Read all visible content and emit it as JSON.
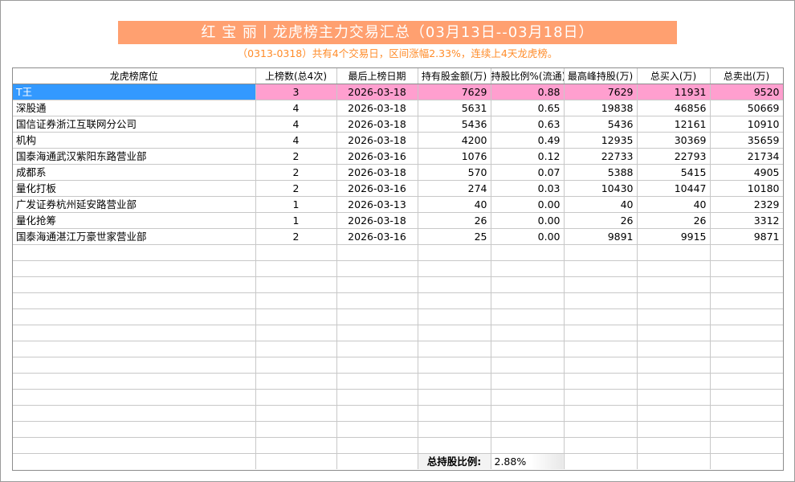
{
  "header": {
    "title": "红 宝 丽丨龙虎榜主力交易汇总（03月13日--03月18日）",
    "subtitle": "（0313-0318）共有4个交易日，区间涨幅2.33%，连续上4天龙虎榜。"
  },
  "colors": {
    "title_bg": "#ffa070",
    "subtitle_text": "#ff8c2a",
    "selected_row_bg": "#ff9fcf",
    "selected_cell_bg": "#3399ff"
  },
  "table": {
    "columns": [
      "龙虎榜席位",
      "上榜数(总4次)",
      "最后上榜日期",
      "持有股金额(万)",
      "持股比例%(流通)",
      "最高峰持股(万)",
      "总买入(万)",
      "总卖出(万)"
    ],
    "rows": [
      [
        "T王",
        "3",
        "2026-03-18",
        "7629",
        "0.88",
        "7629",
        "11931",
        "9520"
      ],
      [
        "深股通",
        "4",
        "2026-03-18",
        "5631",
        "0.65",
        "19838",
        "46856",
        "50669"
      ],
      [
        "国信证券浙江互联网分公司",
        "4",
        "2026-03-18",
        "5436",
        "0.63",
        "5436",
        "12161",
        "10910"
      ],
      [
        "机构",
        "4",
        "2026-03-18",
        "4200",
        "0.49",
        "12935",
        "30369",
        "35659"
      ],
      [
        "国泰海通武汉紫阳东路营业部",
        "2",
        "2026-03-16",
        "1076",
        "0.12",
        "22733",
        "22793",
        "21734"
      ],
      [
        "成都系",
        "2",
        "2026-03-18",
        "570",
        "0.07",
        "5388",
        "5415",
        "4905"
      ],
      [
        "量化打板",
        "2",
        "2026-03-16",
        "274",
        "0.03",
        "10430",
        "10447",
        "10180"
      ],
      [
        "广发证券杭州延安路营业部",
        "1",
        "2026-03-13",
        "40",
        "0.00",
        "40",
        "40",
        "2329"
      ],
      [
        "量化抢筹",
        "1",
        "2026-03-18",
        "26",
        "0.00",
        "26",
        "26",
        "3312"
      ],
      [
        "国泰海通湛江万豪世家营业部",
        "2",
        "2026-03-16",
        "25",
        "0.00",
        "9891",
        "9915",
        "9871"
      ]
    ],
    "selected_row": 0,
    "footer": {
      "label": "总持股比例:",
      "value": "2.88%"
    }
  }
}
